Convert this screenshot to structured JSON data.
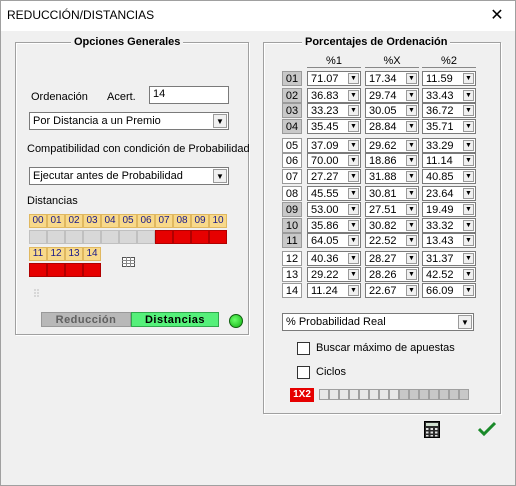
{
  "window": {
    "title": "REDUCCIÓN/DISTANCIAS",
    "close_glyph": "✕"
  },
  "left": {
    "legend": "Opciones Generales",
    "ordenacion_label": "Ordenación",
    "acert_label": "Acert.",
    "acert_value": "14",
    "ordenacion_select": "Por Distancia a un Premio",
    "compat_label": "Compatibilidad con condición de Probabilidad",
    "compat_select": "Ejecutar antes de Probabilidad",
    "distancias_label": "Distancias",
    "distancias_row1": [
      "00",
      "01",
      "02",
      "03",
      "04",
      "05",
      "06",
      "07",
      "08",
      "09",
      "10"
    ],
    "distancias_row1_state": [
      "gray",
      "gray",
      "gray",
      "gray",
      "gray",
      "gray",
      "gray",
      "red",
      "red",
      "red",
      "red"
    ],
    "distancias_row2": [
      "11",
      "12",
      "13",
      "14"
    ],
    "distancias_row2_state": [
      "red",
      "red",
      "red",
      "red"
    ]
  },
  "tabs": [
    {
      "label": "Reducción",
      "active": false
    },
    {
      "label": "Distancias",
      "active": true
    }
  ],
  "right": {
    "legend": "Porcentajes de Ordenación",
    "columns": [
      "%1",
      "%X",
      "%2"
    ],
    "rows": [
      {
        "n": "01",
        "shade": true,
        "v": [
          "71.07",
          "17.34",
          "11.59"
        ]
      },
      {
        "n": "02",
        "shade": true,
        "v": [
          "36.83",
          "29.74",
          "33.43"
        ]
      },
      {
        "n": "03",
        "shade": true,
        "v": [
          "33.23",
          "30.05",
          "36.72"
        ]
      },
      {
        "n": "04",
        "shade": true,
        "v": [
          "35.45",
          "28.84",
          "35.71"
        ]
      },
      {
        "n": "05",
        "shade": false,
        "v": [
          "37.09",
          "29.62",
          "33.29"
        ]
      },
      {
        "n": "06",
        "shade": false,
        "v": [
          "70.00",
          "18.86",
          "11.14"
        ]
      },
      {
        "n": "07",
        "shade": false,
        "v": [
          "27.27",
          "31.88",
          "40.85"
        ]
      },
      {
        "n": "08",
        "shade": false,
        "v": [
          "45.55",
          "30.81",
          "23.64"
        ]
      },
      {
        "n": "09",
        "shade": true,
        "v": [
          "53.00",
          "27.51",
          "19.49"
        ]
      },
      {
        "n": "10",
        "shade": true,
        "v": [
          "35.86",
          "30.82",
          "33.32"
        ]
      },
      {
        "n": "11",
        "shade": true,
        "v": [
          "64.05",
          "22.52",
          "13.43"
        ]
      },
      {
        "n": "12",
        "shade": false,
        "v": [
          "40.36",
          "28.27",
          "31.37"
        ]
      },
      {
        "n": "13",
        "shade": false,
        "v": [
          "29.22",
          "28.26",
          "42.52"
        ]
      },
      {
        "n": "14",
        "shade": false,
        "v": [
          "11.24",
          "22.67",
          "66.09"
        ]
      }
    ],
    "prob_select": "% Probabilidad Real",
    "buscar_label": "Buscar máximo de apuestas",
    "ciclos_label": "Ciclos",
    "onex2_label": "1X2",
    "progress_filled": [
      false,
      false,
      false,
      false,
      false,
      false,
      false,
      false,
      true,
      true,
      true,
      true,
      true,
      true,
      true
    ]
  },
  "icons": {
    "calculator": "calculator-icon",
    "accept": "checkmark-icon"
  }
}
